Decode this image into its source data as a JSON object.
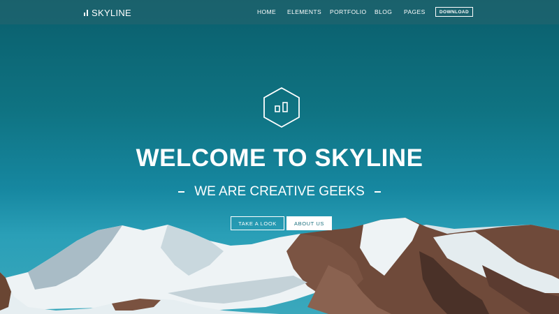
{
  "brand": {
    "name": "SKYLINE"
  },
  "nav": {
    "items": [
      "HOME",
      "ELEMENTS",
      "PORTFOLIO",
      "BLOG",
      "PAGES"
    ],
    "cta_label": "DOWNLOAD"
  },
  "hero": {
    "title": "WELCOME TO SKYLINE",
    "subtitle": "WE ARE CREATIVE GEEKS",
    "primary_button": "TAKE A LOOK",
    "secondary_button": "ABOUT US"
  },
  "colors": {
    "sky_top": "#0a5e6c",
    "sky_bottom": "#3aa8bc",
    "snow": "#eef3f5",
    "rock": "#5a3a2e",
    "button_text": "#1b6f7e"
  },
  "icons": {
    "logo": "bar-chart-icon",
    "hero_badge": "hexagon-bar-chart-icon"
  }
}
